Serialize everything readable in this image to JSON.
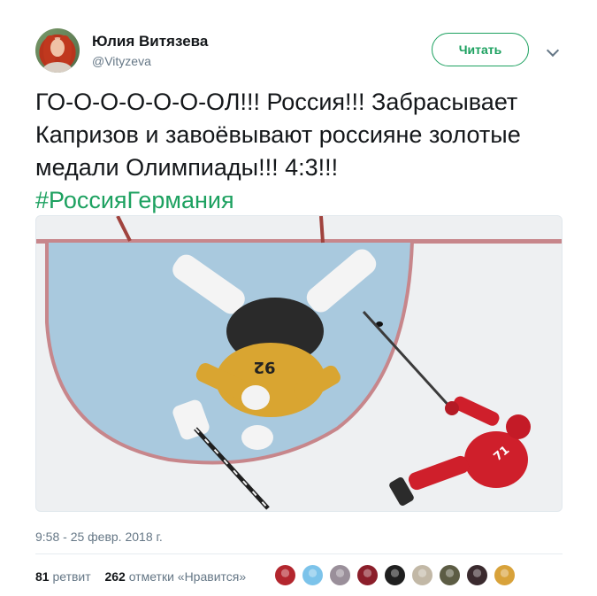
{
  "author": {
    "name": "Юлия Витязева",
    "handle": "@Vityzeva"
  },
  "follow_button": {
    "label": "Читать"
  },
  "tweet": {
    "text": "ГО-О-О-О-О-О-ОЛ!!! Россия!!! Забрасывает Капризов и завоёвывают россияне золотые медали Олимпиады!!! 4:3!!!",
    "hashtag": "#РоссияГермания",
    "timestamp": "9:58 - 25 февр. 2018 г."
  },
  "stats": {
    "retweets_count": "81",
    "retweets_label": "ретвит",
    "likes_count": "262",
    "likes_label": "отметки «Нравится»"
  },
  "media": {
    "goalie_number": "92",
    "skater_number": "71"
  },
  "likers": [
    {
      "color": "#b3262e"
    },
    {
      "color": "#7cc3ea"
    },
    {
      "color": "#9a8f9a"
    },
    {
      "color": "#8b1e2a"
    },
    {
      "color": "#1f1f1f"
    },
    {
      "color": "#c2b8a6"
    },
    {
      "color": "#5c5c44"
    },
    {
      "color": "#3a2a2e"
    },
    {
      "color": "#d8a23a"
    }
  ],
  "colors": {
    "accent": "#1da160",
    "text": "#14171a",
    "muted": "#657786"
  }
}
